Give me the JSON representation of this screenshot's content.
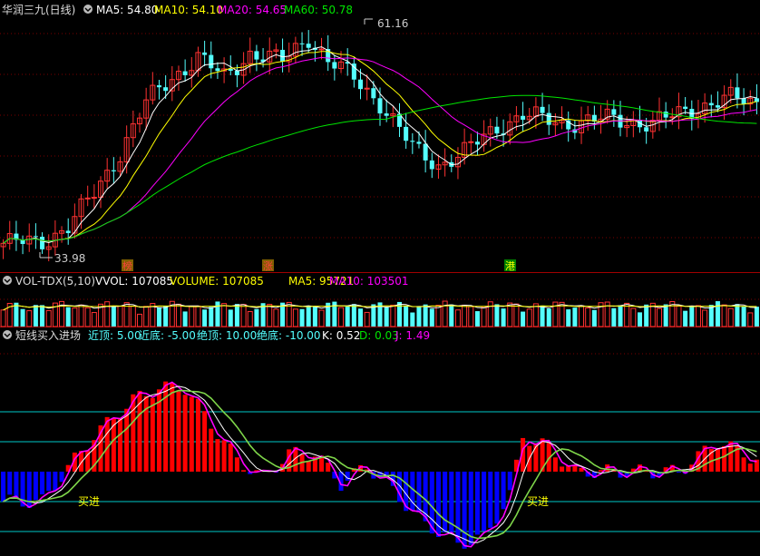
{
  "price_header": {
    "name": "华润三九(日线)",
    "ma5": "MA5: 54.80",
    "ma10": "MA10: 54.10",
    "ma20": "MA20: 54.65",
    "ma60": "MA60: 50.78"
  },
  "price_annotations": {
    "high_label": "61.16",
    "low_label": "33.98",
    "markers": [
      "榜",
      "涨",
      "港"
    ]
  },
  "volume_header": {
    "name": "VOL-TDX(5,10)",
    "vvol": "VVOL: 107085",
    "volume": "VOLUME: 107085",
    "ma5": "MA5: 95721",
    "ma10": "MA10: 103501"
  },
  "indicator_header": {
    "name": "短线买入进场",
    "near_top": "近顶: 5.00",
    "near_bottom": "近底: -5.00",
    "abs_top": "绝顶: 10.00",
    "abs_bottom": "绝底: -10.00",
    "k": "K: 0.52",
    "d": "D: 0.03",
    "j": "J: 1.49"
  },
  "signals": [
    "买进",
    "买进"
  ],
  "colors": {
    "up": "#ff3232",
    "down": "#54ffff",
    "ma5": "#ffffff",
    "ma10": "#ffff00",
    "ma20": "#ff00ff",
    "ma60": "#00e600",
    "grid": "#8b0000",
    "indicator_pos": "#ff0000",
    "indicator_neg": "#0000ff",
    "ref_lines": "#00c8c8",
    "k_line": "#ffffff",
    "d_line": "#ffff00",
    "j_line": "#ff00ff"
  }
}
